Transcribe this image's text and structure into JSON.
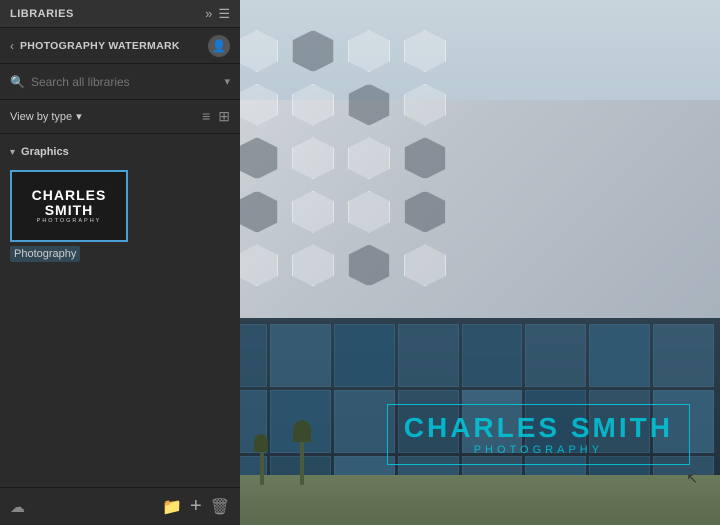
{
  "libraries": {
    "title": "Libraries",
    "header_icon_expand": "»",
    "header_icon_menu": "☰"
  },
  "watermark_bar": {
    "chevron": "‹",
    "title": "Photography Watermark",
    "user_icon": "👤"
  },
  "search": {
    "placeholder": "Search all libraries",
    "chevron": "▾"
  },
  "view_bar": {
    "label": "View by type",
    "chevron": "▾",
    "icon_list1": "≡",
    "icon_list2": "⊞"
  },
  "graphics_section": {
    "chevron": "▾",
    "title": "Graphics"
  },
  "library_item": {
    "thumb_title": "CHARLES SMITH",
    "thumb_subtitle": "PHOTOGRAPHY",
    "label": "Photography"
  },
  "bottom_toolbar": {
    "cloud_icon": "☁",
    "folder_icon": "📁",
    "add_icon": "+",
    "delete_icon": "🗑"
  },
  "watermark": {
    "title": "CHARLES SMITH",
    "subtitle": "PHOTOGRAPHY"
  },
  "colors": {
    "accent": "#4a9fd4",
    "watermark_color": "rgba(0,200,220,0.85)",
    "sidebar_bg": "#2b2b2b"
  }
}
